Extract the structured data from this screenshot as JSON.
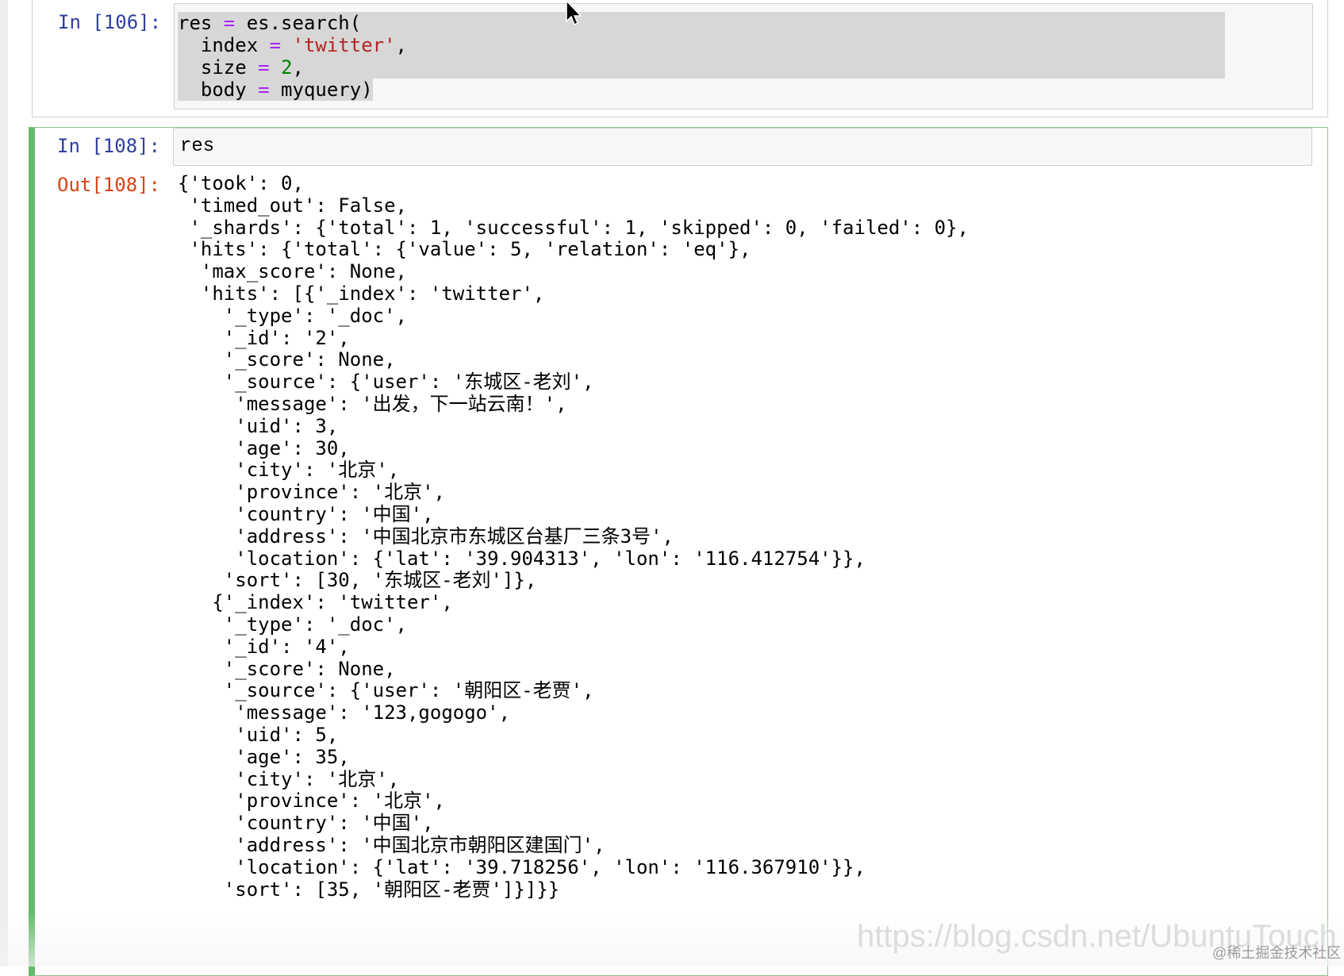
{
  "cells": [
    {
      "prompt": "In [106]:",
      "code_lines": [
        {
          "parts": [
            [
              "res ",
              "t"
            ],
            [
              "=",
              "op"
            ],
            [
              " es.search(",
              "t"
            ]
          ]
        },
        {
          "parts": [
            [
              "  index ",
              "t"
            ],
            [
              "=",
              "op"
            ],
            [
              " ",
              "t"
            ],
            [
              "'twitter'",
              "s"
            ],
            [
              ",",
              "t"
            ]
          ]
        },
        {
          "parts": [
            [
              "  size ",
              "t"
            ],
            [
              "=",
              "op"
            ],
            [
              " ",
              "t"
            ],
            [
              "2",
              "n"
            ],
            [
              ",",
              "t"
            ]
          ]
        },
        {
          "parts": [
            [
              "  body ",
              "t"
            ],
            [
              "=",
              "op"
            ],
            [
              " myquery)",
              "t"
            ]
          ]
        }
      ]
    },
    {
      "in_prompt": "In [108]:",
      "code": "res",
      "out_prompt": "Out[108]:",
      "output_lines": [
        "{'took': 0,",
        " 'timed_out': False,",
        " '_shards': {'total': 1, 'successful': 1, 'skipped': 0, 'failed': 0},",
        " 'hits': {'total': {'value': 5, 'relation': 'eq'},",
        "  'max_score': None,",
        "  'hits': [{'_index': 'twitter',",
        "    '_type': '_doc',",
        "    '_id': '2',",
        "    '_score': None,",
        "    '_source': {'user': '东城区-老刘',",
        "     'message': '出发，下一站云南！',",
        "     'uid': 3,",
        "     'age': 30,",
        "     'city': '北京',",
        "     'province': '北京',",
        "     'country': '中国',",
        "     'address': '中国北京市东城区台基厂三条3号',",
        "     'location': {'lat': '39.904313', 'lon': '116.412754'}},",
        "    'sort': [30, '东城区-老刘']},",
        "   {'_index': 'twitter',",
        "    '_type': '_doc',",
        "    '_id': '4',",
        "    '_score': None,",
        "    '_source': {'user': '朝阳区-老贾',",
        "     'message': '123,gogogo',",
        "     'uid': 5,",
        "     'age': 35,",
        "     'city': '北京',",
        "     'province': '北京',",
        "     'country': '中国',",
        "     'address': '中国北京市朝阳区建国门',",
        "     'location': {'lat': '39.718256', 'lon': '116.367910'}},",
        "    'sort': [35, '朝阳区-老贾']}]}}"
      ]
    }
  ],
  "watermark": {
    "url": "https://blog.csdn.net/UbuntuTouch",
    "community": "@稀土掘金技术社区"
  },
  "colors": {
    "in_prompt": "#303f9f",
    "out_prompt": "#d84315",
    "selected_cell_border": "#66bb6a",
    "operator": "#aa22ff",
    "string": "#ba2121",
    "number": "#008000"
  },
  "icons": [
    "mouse-pointer-icon"
  ]
}
